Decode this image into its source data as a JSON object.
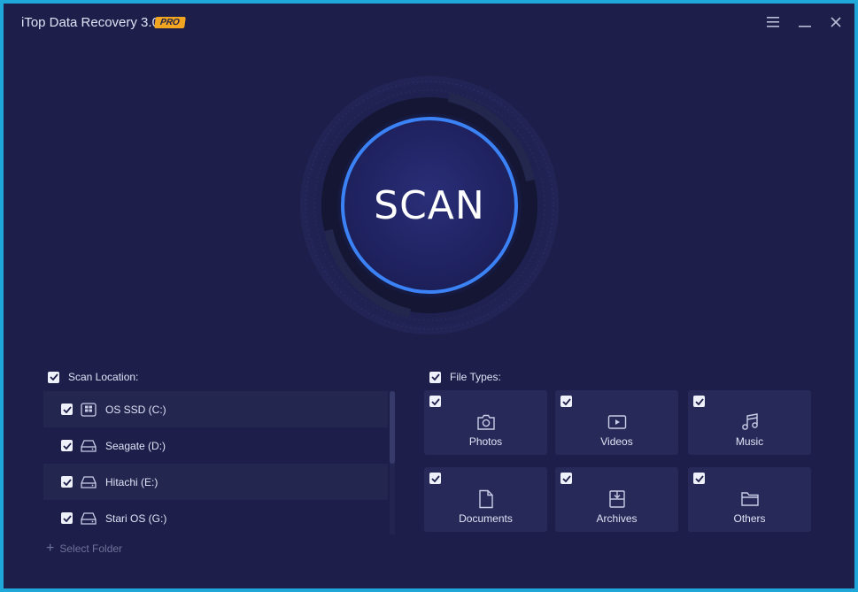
{
  "window": {
    "title": "iTop Data Recovery 3.0",
    "badge": "PRO",
    "controls": {
      "menu_icon": "menu-icon",
      "minimize_icon": "minimize-icon",
      "close_icon": "close-icon"
    }
  },
  "scan": {
    "label": "SCAN"
  },
  "scan_location": {
    "title": "Scan Location:",
    "checked": true,
    "drives": [
      {
        "label": "OS SSD (C:)",
        "checked": true,
        "icon": "windows-drive-icon"
      },
      {
        "label": "Seagate (D:)",
        "checked": true,
        "icon": "hard-drive-icon"
      },
      {
        "label": "Hitachi (E:)",
        "checked": true,
        "icon": "hard-drive-icon"
      },
      {
        "label": "Stari OS (G:)",
        "checked": true,
        "icon": "hard-drive-icon"
      }
    ],
    "select_folder": "Select Folder"
  },
  "file_types": {
    "title": "File Types:",
    "checked": true,
    "items": [
      {
        "label": "Photos",
        "checked": true,
        "icon": "camera-icon"
      },
      {
        "label": "Videos",
        "checked": true,
        "icon": "video-icon"
      },
      {
        "label": "Music",
        "checked": true,
        "icon": "music-icon"
      },
      {
        "label": "Documents",
        "checked": true,
        "icon": "document-icon"
      },
      {
        "label": "Archives",
        "checked": true,
        "icon": "archive-icon"
      },
      {
        "label": "Others",
        "checked": true,
        "icon": "folder-icon"
      }
    ]
  },
  "colors": {
    "frame": "#1ea7d8",
    "background": "#1d1f4a",
    "tile": "#272a58",
    "accent": "#3b82f6",
    "badge": "#f2a521"
  }
}
